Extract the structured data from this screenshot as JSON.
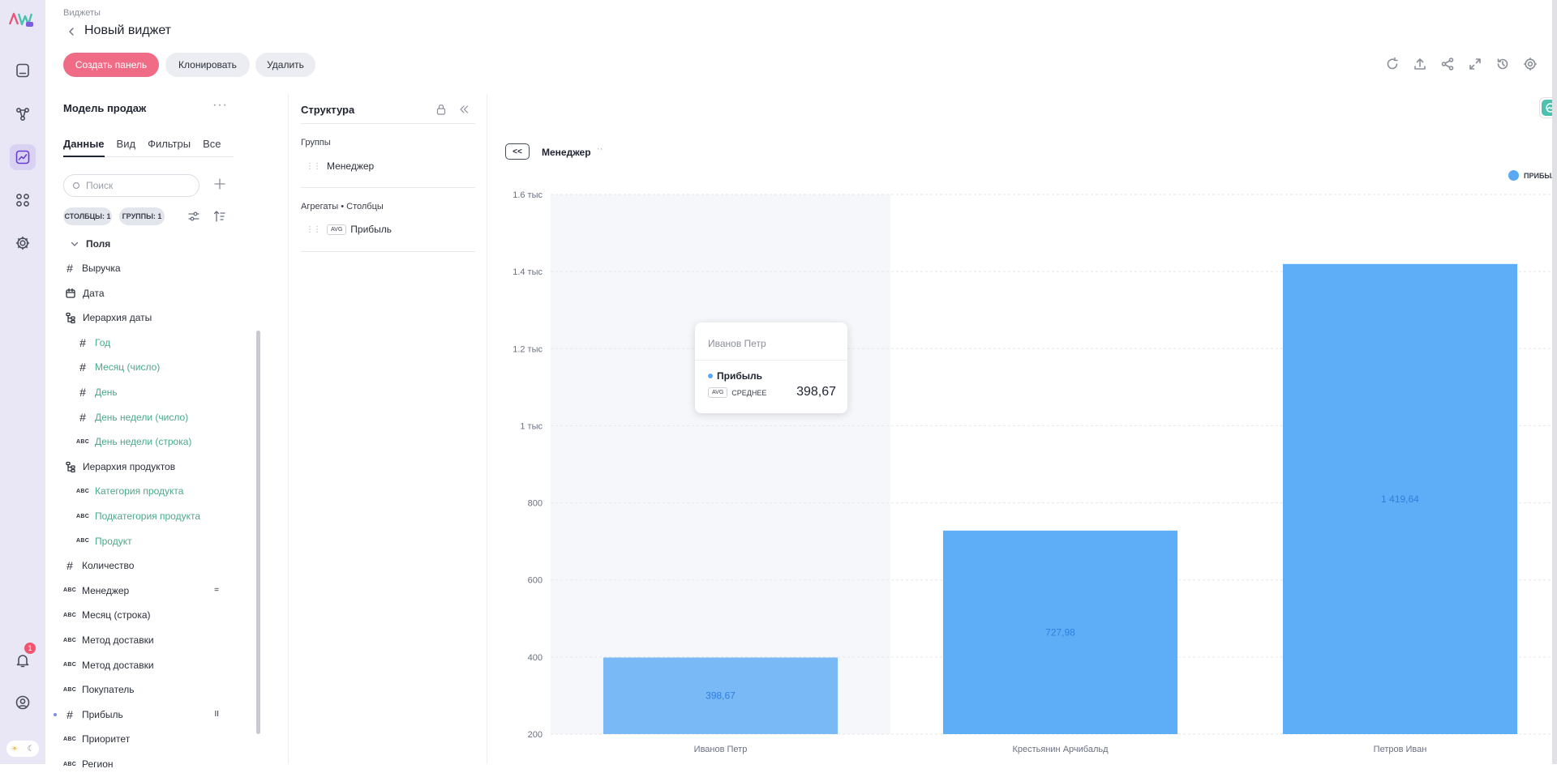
{
  "breadcrumb": "Виджеты",
  "page_title": "Новый виджет",
  "toolbar": {
    "create_panel": "Создать панель",
    "clone": "Клонировать",
    "delete": "Удалить"
  },
  "rail": {
    "notifications_count": "1",
    "theme_light": "☀",
    "theme_dark": "☾"
  },
  "model": {
    "title": "Модель продаж",
    "menu": "···"
  },
  "tabs": [
    {
      "label": "Данные"
    },
    {
      "label": "Вид"
    },
    {
      "label": "Фильтры"
    },
    {
      "label": "Все"
    }
  ],
  "search": {
    "placeholder": "Поиск"
  },
  "chips": {
    "columns": "СТОЛБЦЫ: 1",
    "groups": "ГРУППЫ: 1"
  },
  "fields": {
    "section": "Поля",
    "items": [
      {
        "type": "#",
        "label": "Выручка",
        "indent": 0
      },
      {
        "type": "date",
        "label": "Дата",
        "indent": 0
      },
      {
        "type": "hier",
        "label": "Иерархия даты",
        "indent": 0
      },
      {
        "type": "#",
        "label": "Год",
        "indent": 1
      },
      {
        "type": "#",
        "label": "Месяц (число)",
        "indent": 1
      },
      {
        "type": "#",
        "label": "День",
        "indent": 1
      },
      {
        "type": "#",
        "label": "День недели (число)",
        "indent": 1
      },
      {
        "type": "ABC",
        "label": "День недели (строка)",
        "indent": 1
      },
      {
        "type": "hier",
        "label": "Иерархия продуктов",
        "indent": 0
      },
      {
        "type": "ABC",
        "label": "Категория продукта",
        "indent": 1
      },
      {
        "type": "ABC",
        "label": "Подкатегория продукта",
        "indent": 1
      },
      {
        "type": "ABC",
        "label": "Продукт",
        "indent": 1
      },
      {
        "type": "#",
        "label": "Количество",
        "indent": 0
      },
      {
        "type": "ABC",
        "label": "Менеджер",
        "indent": 0,
        "mark": "="
      },
      {
        "type": "ABC",
        "label": "Месяц (строка)",
        "indent": 0
      },
      {
        "type": "ABC",
        "label": "Метод доставки",
        "indent": 0
      },
      {
        "type": "ABC",
        "label": "Метод доставки",
        "indent": 0
      },
      {
        "type": "ABC",
        "label": "Покупатель",
        "indent": 0
      },
      {
        "type": "#",
        "label": "Прибыль",
        "indent": 0,
        "mark": "II",
        "dot": true
      },
      {
        "type": "ABC",
        "label": "Приоритет",
        "indent": 0
      },
      {
        "type": "ABC",
        "label": "Регион",
        "indent": 0
      }
    ]
  },
  "structure": {
    "title": "Структура",
    "groups_label": "Группы",
    "group_item": "Менеджер",
    "aggregates_label": "Агрегаты • Столбцы",
    "agg_badge": "AVG",
    "agg_item": "Прибыль"
  },
  "chart_header": {
    "drill_label": "<<",
    "dimension": "Менеджер",
    "menu": "··"
  },
  "legend": {
    "label": "ПРИБЫЛЬ",
    "menu": "··"
  },
  "colors": {
    "accent_pink": "#f06b86",
    "bar": "#5eaef7",
    "bar_hover": "#79b9f6",
    "teal": "#4cc1b0"
  },
  "chart_data": {
    "type": "bar",
    "categories": [
      "Иванов Петр",
      "Крестьянин Арчибальд",
      "Петров Иван"
    ],
    "series": [
      {
        "name": "ПРИБЫЛЬ",
        "values": [
          398.67,
          727.98,
          1419.64
        ]
      }
    ],
    "data_labels": [
      "398,67",
      "727,98",
      "1 419,64"
    ],
    "yticks": [
      200,
      400,
      600,
      800,
      1000,
      1200,
      1400,
      1600
    ],
    "ytick_labels": [
      "200",
      "400",
      "600",
      "800",
      "1 тыс",
      "1.2 тыс",
      "1.4 тыс",
      "1.6 тыс"
    ],
    "ylim": [
      200,
      1600
    ],
    "grid": true,
    "legend_position": "top-right",
    "highlighted_category": "Иванов Петр"
  },
  "tooltip": {
    "title": "Иванов Петр",
    "series": "Прибыль",
    "agg_badge": "AVG",
    "agg_label": "СРЕДНЕЕ",
    "value": "398,67"
  }
}
